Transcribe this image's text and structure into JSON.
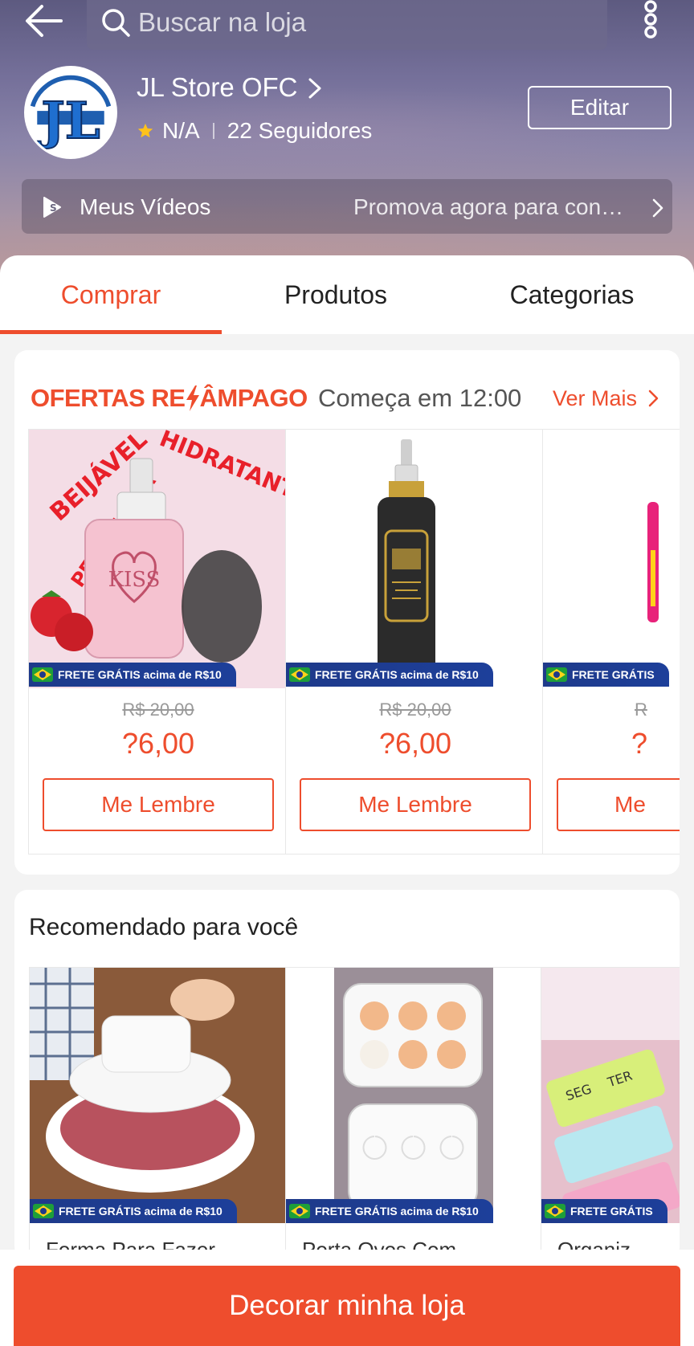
{
  "header": {
    "search_placeholder": "Buscar na loja"
  },
  "store": {
    "name": "JL Store OFC",
    "rating": "N/A",
    "followers": "22 Seguidores",
    "edit_label": "Editar",
    "logo_text": "JL"
  },
  "videos": {
    "label": "Meus Vídeos",
    "promo": "Promova agora para con…"
  },
  "tabs": [
    {
      "label": "Comprar",
      "active": true
    },
    {
      "label": "Produtos",
      "active": false
    },
    {
      "label": "Categorias",
      "active": false
    }
  ],
  "flash": {
    "title_part1": "OFERTAS RE",
    "title_part2": "ÂMPAGO",
    "starts": "Começa em 12:00",
    "see_more": "Ver Mais",
    "products": [
      {
        "image_text": [
          "BEIJÁVEL",
          "HIDRATANTE",
          "PELE MAGIA",
          "KISS"
        ],
        "free_shipping": "FRETE GRÁTIS acima de R$10",
        "old_price": "R$ 20,00",
        "price": "?6,00",
        "button": "Me Lembre"
      },
      {
        "free_shipping": "FRETE GRÁTIS acima de R$10",
        "old_price": "R$ 20,00",
        "price": "?6,00",
        "button": "Me Lembre"
      },
      {
        "free_shipping": "FRETE GRÁTIS",
        "old_price": "R",
        "price": "?",
        "button": "Me"
      }
    ]
  },
  "recommended": {
    "title": "Recomendado para você",
    "items": [
      {
        "free_shipping": "FRETE GRÁTIS acima de R$10",
        "name": "Forma Para Fazer"
      },
      {
        "free_shipping": "FRETE GRÁTIS acima de R$10",
        "name": "Porta Ovos Com"
      },
      {
        "free_shipping": "FRETE GRÁTIS",
        "name": "Organiz",
        "image_text": [
          "SEG",
          "TER"
        ]
      }
    ]
  },
  "bottom": {
    "decorate_label": "Decorar minha loja"
  },
  "colors": {
    "accent": "#ee4d2d",
    "shipping_badge": "#1e3a8a"
  }
}
